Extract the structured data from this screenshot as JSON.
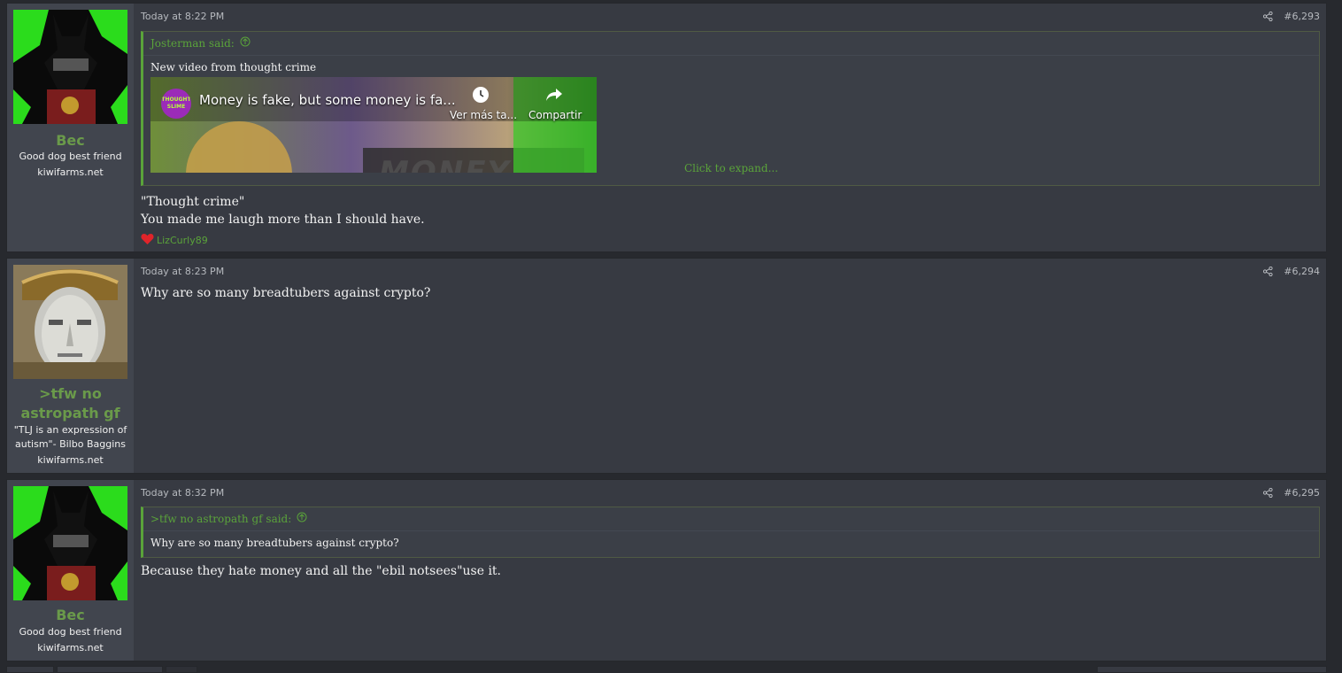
{
  "posts": [
    {
      "username": "Bec",
      "user_title": "Good dog best friend",
      "user_site": "kiwifarms.net",
      "date": "Today at 8:22 PM",
      "number": "#6,293",
      "quote": {
        "author": "Josterman said:",
        "text": "New video from thought crime",
        "embed_title": "Money is fake, but some money is fa...",
        "embed_watch_later": "Ver más ta...",
        "embed_share": "Compartir",
        "embed_channel_badge": "THOUGHT SLIME",
        "embed_bg_word": "MONEY",
        "click_to_expand": "Click to expand..."
      },
      "body": [
        "\"Thought crime\"",
        "You made me laugh more than I should have."
      ],
      "reaction_user": "LizCurly89"
    },
    {
      "username": ">tfw no astropath gf",
      "user_title": "\"TLJ is an expression of autism\"- Bilbo Baggins",
      "user_site": "kiwifarms.net",
      "date": "Today at 8:23 PM",
      "number": "#6,294",
      "body": [
        "Why are so many breadtubers against crypto?"
      ]
    },
    {
      "username": "Bec",
      "user_title": "Good dog best friend",
      "user_site": "kiwifarms.net",
      "date": "Today at 8:32 PM",
      "number": "#6,295",
      "quote": {
        "author": ">tfw no astropath gf said:",
        "text": "Why are so many breadtubers against crypto?"
      },
      "body": [
        "Because they hate money and all the \"ebil notsees\"use it."
      ]
    }
  ],
  "colors": {
    "accent_green": "#5aa33a",
    "username_green": "#6a9a4a",
    "post_bg": "#373a42",
    "user_cell_bg": "#41454e",
    "page_bg": "#27292e"
  }
}
